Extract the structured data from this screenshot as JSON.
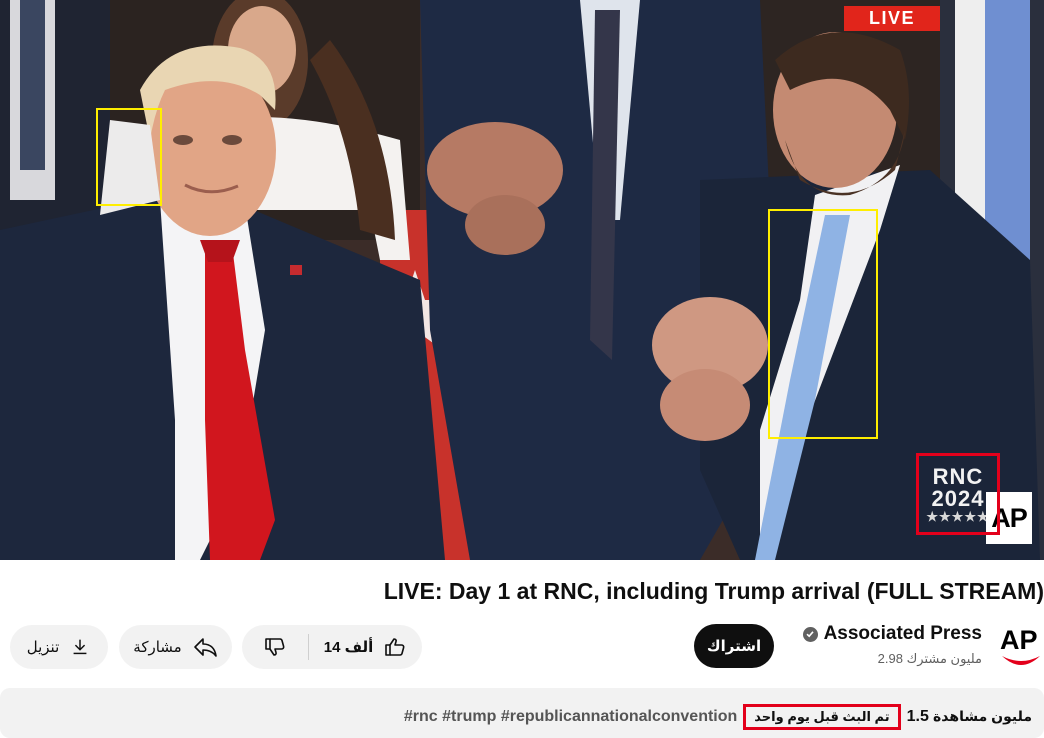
{
  "player": {
    "live_label": "LIVE",
    "rnc_logo": {
      "line1": "RNC",
      "line2": "2024",
      "stars": "★★★★★"
    },
    "ap_badge": "AP",
    "live_color": "#e1251b"
  },
  "video": {
    "title": "LIVE: Day 1 at RNC, including Trump arrival (FULL STREAM)"
  },
  "channel": {
    "name": "Associated Press",
    "subscribers": "2.98 مليون مشترك",
    "subscribe_label": "اشتراك",
    "avatar_text": "AP",
    "verified_icon": "verified-check-icon"
  },
  "actions": {
    "likes": "14 ألف",
    "like_icon": "thumbs-up-icon",
    "dislike_icon": "thumbs-down-icon",
    "share_label": "مشاركة",
    "share_icon": "share-arrow-icon",
    "download_label": "تنزيل",
    "download_icon": "download-icon"
  },
  "description": {
    "views_num": "1.5",
    "views_word": "مليون مشاهدة",
    "stream_time": "تم البث قبل يوم واحد",
    "hashtags": "#rnc #trump #republicannationalconvention"
  },
  "colors": {
    "annotation_yellow": "#ffee00",
    "annotation_red": "#e3001b",
    "subscribe_bg": "#0f0f0f",
    "pill_bg": "#f2f2f2"
  }
}
